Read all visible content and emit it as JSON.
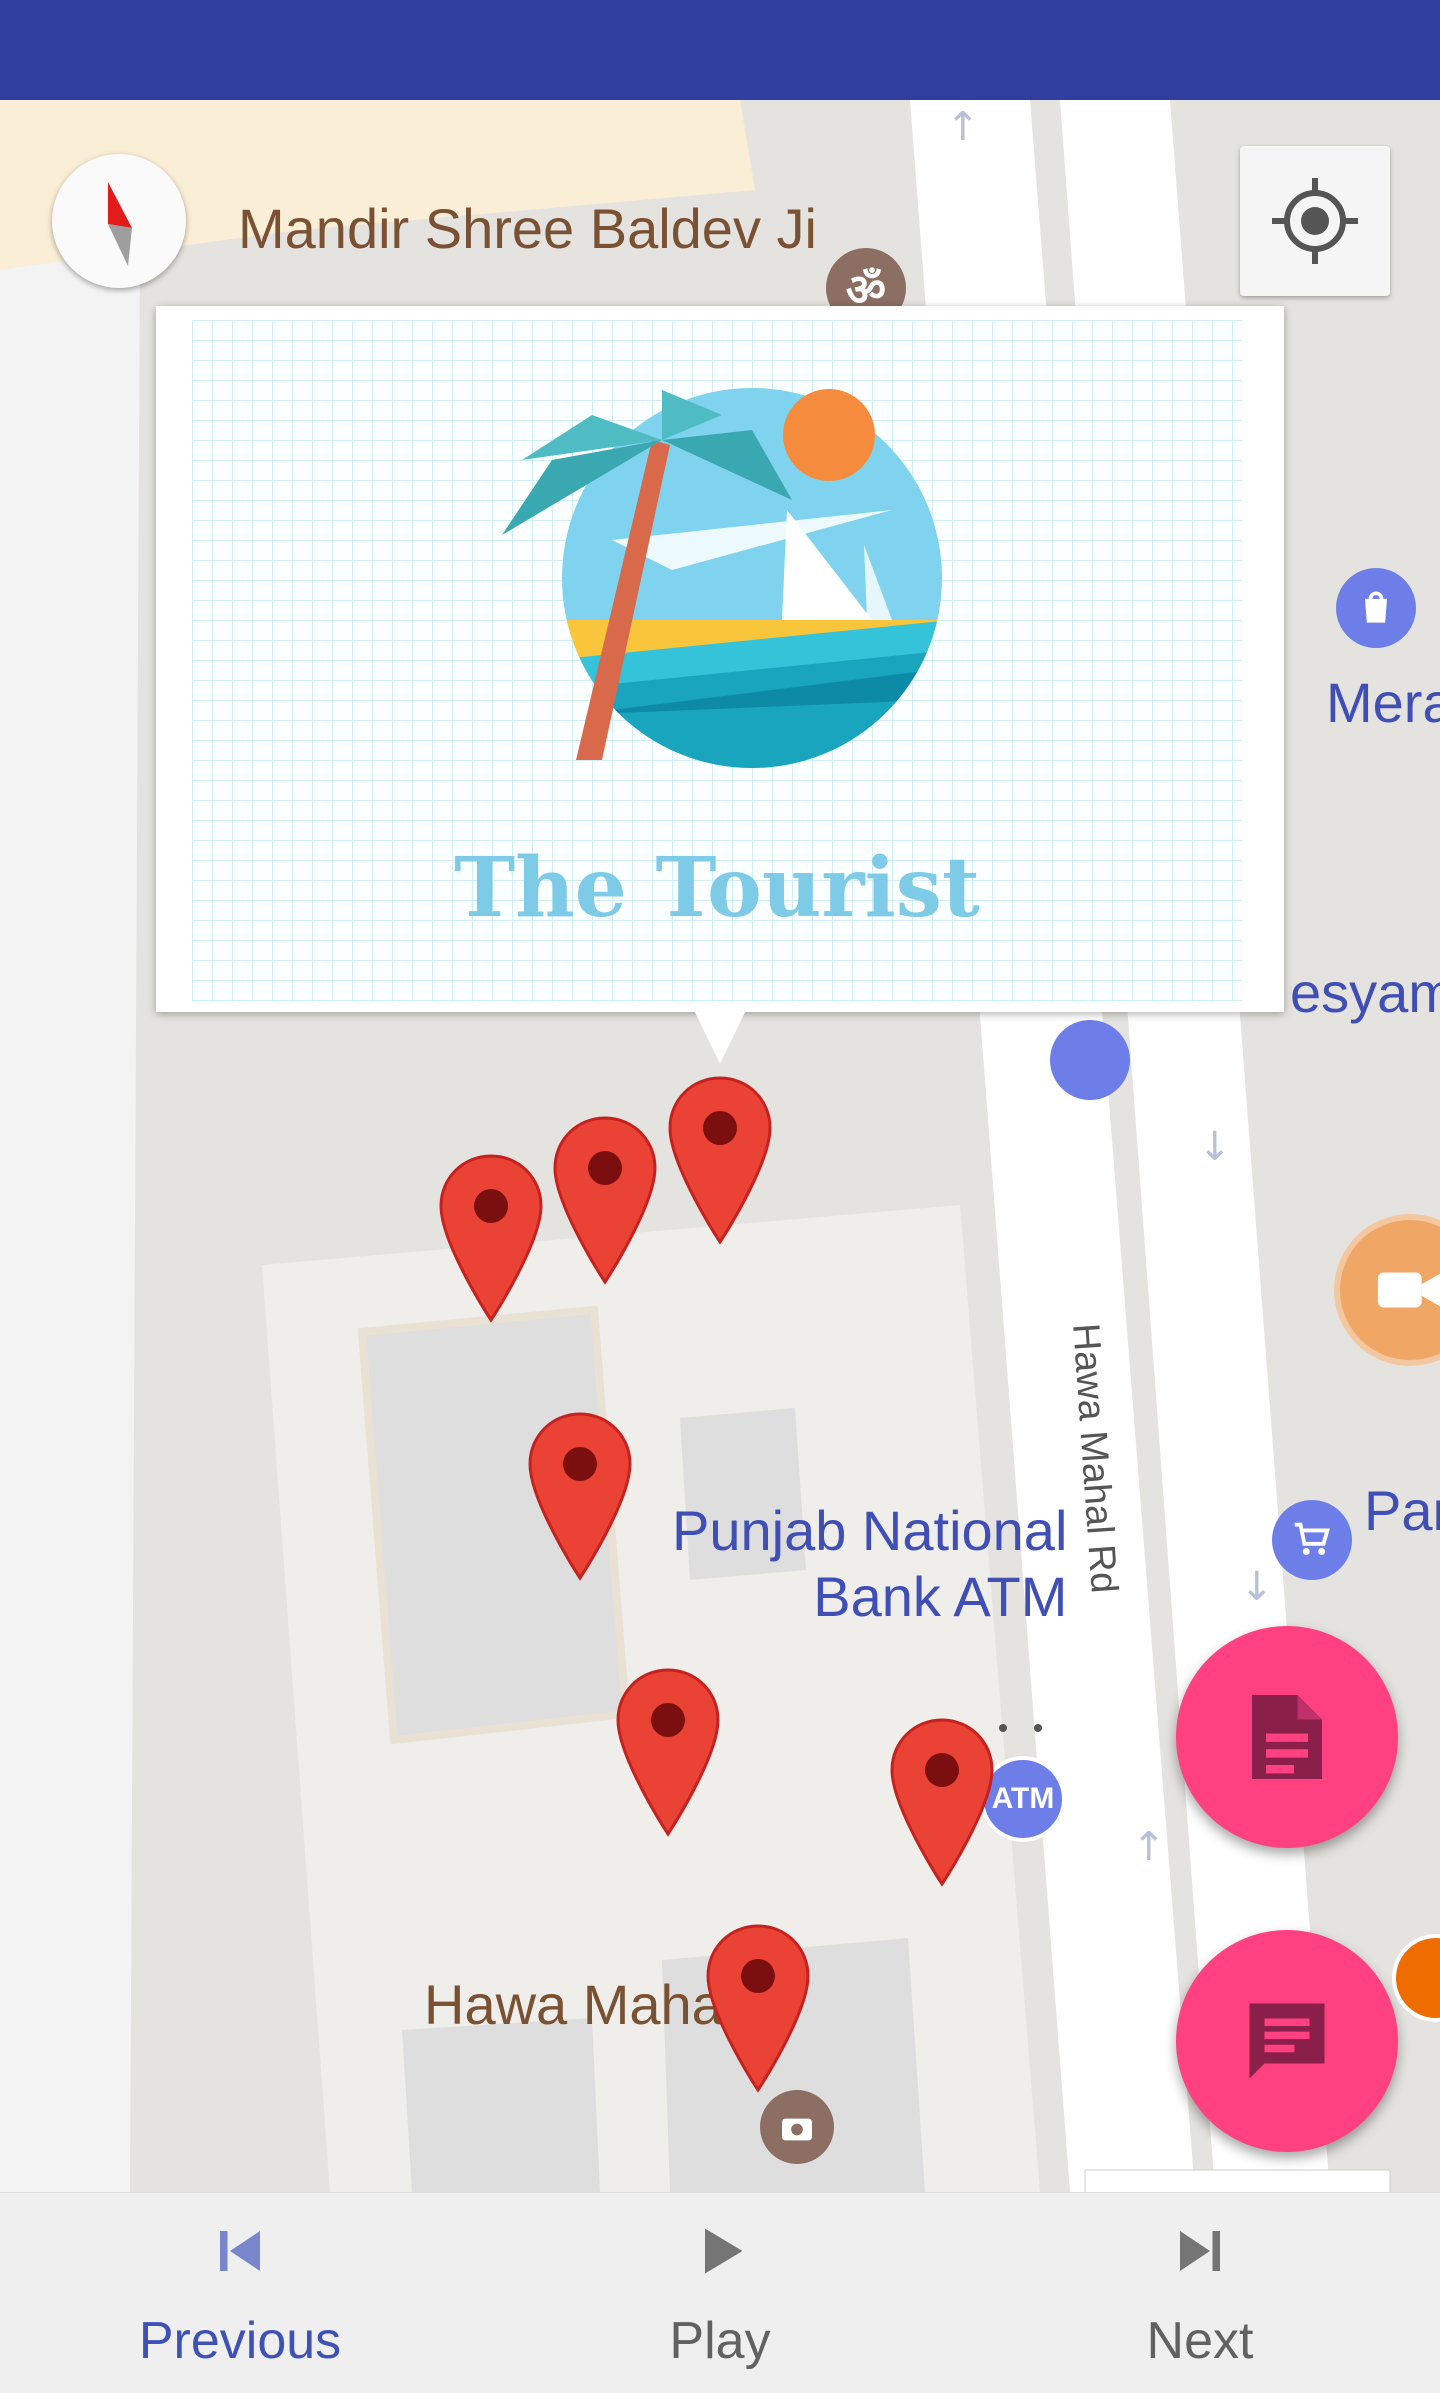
{
  "map": {
    "places": {
      "temple": "Mandir Shree Baldev Ji",
      "bank_atm_line1": "Punjab National",
      "bank_atm_line2": "Bank ATM",
      "palace": "Hawa Mahal",
      "partial_top_right": "Mera",
      "partial_mid_right": "esyam",
      "partial_shop_right": "Pan"
    },
    "road": "Hawa Mahal Rd",
    "atm_badge": "ATM",
    "om_symbol": "ॐ"
  },
  "info_window": {
    "title": "The Tourist"
  },
  "bottom_nav": {
    "previous": "Previous",
    "play": "Play",
    "next": "Next"
  },
  "colors": {
    "status_bar": "#303f9f",
    "pin": "#ea4335",
    "fab": "#ff4081",
    "nav_active": "#3f51b5",
    "nav_inactive": "#757575"
  },
  "icons": [
    "compass-icon",
    "my-location-icon",
    "document-icon",
    "chat-icon",
    "skip-previous-icon",
    "play-icon",
    "skip-next-icon"
  ]
}
